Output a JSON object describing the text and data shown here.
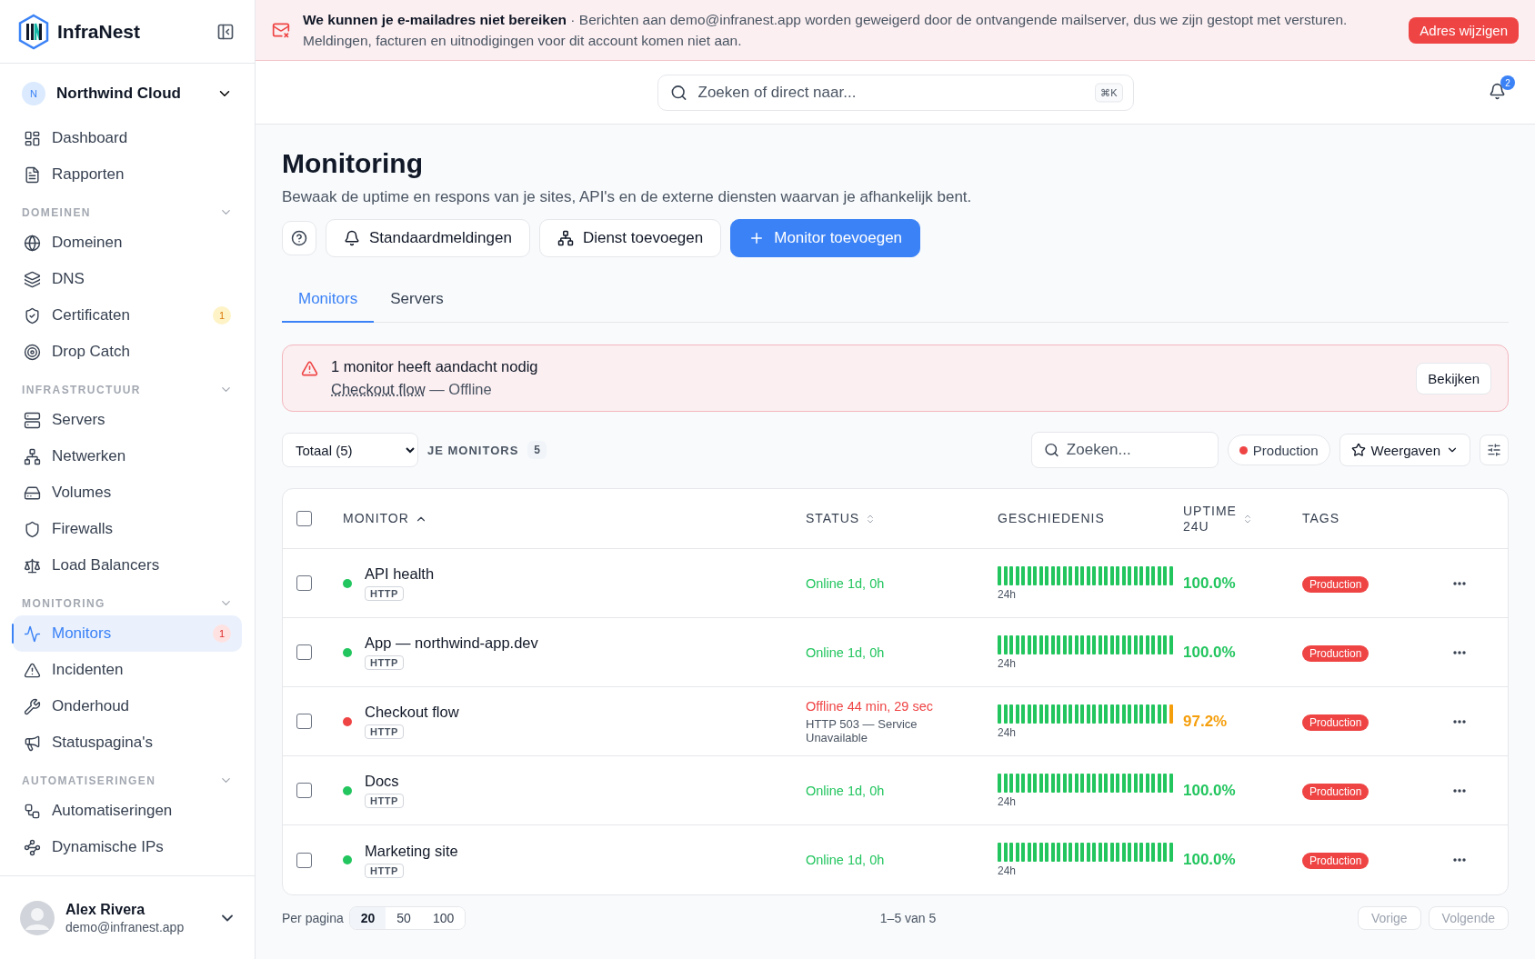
{
  "sidebar": {
    "brand": "InfraNest",
    "workspace": {
      "initial": "N",
      "name": "Northwind Cloud"
    },
    "groups": [
      {
        "items": [
          {
            "label": "Dashboard",
            "selected": false
          },
          {
            "label": "Rapporten",
            "selected": false
          }
        ]
      },
      {
        "heading": "DOMEINEN",
        "expanded": true,
        "items": [
          {
            "label": "Domeinen",
            "selected": false
          },
          {
            "label": "DNS",
            "selected": false
          },
          {
            "label": "Certificaten",
            "selected": false,
            "badge": {
              "text": "1",
              "kind": "warning"
            }
          },
          {
            "label": "Drop Catch",
            "selected": false
          }
        ]
      },
      {
        "heading": "INFRASTRUCTUUR",
        "expanded": true,
        "items": [
          {
            "label": "Servers",
            "selected": false
          },
          {
            "label": "Netwerken",
            "selected": false
          },
          {
            "label": "Volumes",
            "selected": false
          },
          {
            "label": "Firewalls",
            "selected": false
          },
          {
            "label": "Load Balancers",
            "selected": false
          }
        ]
      },
      {
        "heading": "MONITORING",
        "expanded": true,
        "items": [
          {
            "label": "Monitors",
            "selected": true,
            "badge": {
              "text": "1",
              "kind": "danger"
            }
          },
          {
            "label": "Incidenten",
            "selected": false
          },
          {
            "label": "Onderhoud",
            "selected": false
          },
          {
            "label": "Statuspagina's",
            "selected": false
          }
        ]
      },
      {
        "heading": "AUTOMATISERINGEN",
        "expanded": true,
        "items": [
          {
            "label": "Automatiseringen",
            "selected": false
          },
          {
            "label": "Dynamische IPs",
            "selected": false
          }
        ]
      }
    ],
    "user": {
      "name": "Alex Rivera",
      "email": "demo@infranest.app"
    }
  },
  "banner": {
    "title": "We kunnen je e-mailadres niet bereiken",
    "message": " · Berichten aan demo@infranest.app worden geweigerd door de ontvangende mailserver, dus we zijn gestopt met versturen. Meldingen, facturen en uitnodigingen voor dit account komen niet aan.",
    "action": "Adres wijzigen"
  },
  "topbar": {
    "search_placeholder": "Zoeken of direct naar...",
    "shortcut": "⌘K",
    "notifications": "2"
  },
  "page": {
    "title": "Monitoring",
    "description": "Bewaak de uptime en respons van je sites, API's en de externe diensten waarvan je afhankelijk bent.",
    "actions": [
      {
        "label": "Standaardmeldingen",
        "kind": "secondary"
      },
      {
        "label": "Dienst toevoegen",
        "kind": "secondary"
      },
      {
        "label": "Monitor toevoegen",
        "kind": "primary"
      }
    ],
    "tabs": [
      {
        "label": "Monitors",
        "selected": true
      },
      {
        "label": "Servers",
        "selected": false
      }
    ]
  },
  "alert": {
    "title": "1 monitor heeft aandacht nodig",
    "link": "Checkout flow",
    "detail": " — Offline",
    "action": "Bekijken"
  },
  "toolbar": {
    "filter": "Totaal (5)",
    "label": "JE MONITORS",
    "count": "5",
    "search_placeholder": "Zoeken...",
    "chip": {
      "label": "Production",
      "color": "#ef4444"
    },
    "views": "Weergaven"
  },
  "table": {
    "columns": [
      {
        "label": "MONITOR",
        "sorted": true
      },
      {
        "label": "STATUS",
        "sorted": false
      },
      {
        "label": "GESCHIEDENIS"
      },
      {
        "label": "UPTIME 24U",
        "sorted": false
      },
      {
        "label": "TAGS"
      }
    ],
    "all_checked": false,
    "rows": [
      {
        "checked": false,
        "online": true,
        "name": "API health",
        "type": "HTTP",
        "status": "Online 1d, 0h",
        "history_ok": [
          true,
          true,
          true,
          true,
          true,
          true,
          true,
          true,
          true,
          true,
          true,
          true,
          true,
          true,
          true,
          true,
          true,
          true,
          true,
          true,
          true,
          true,
          true,
          true,
          true,
          true,
          true,
          true,
          true,
          true
        ],
        "history_label": "24h",
        "uptime": "100.0%",
        "tags": [
          {
            "label": "Production",
            "color": "#ef4444"
          }
        ]
      },
      {
        "checked": false,
        "online": true,
        "name": "App — northwind-app.dev",
        "type": "HTTP",
        "status": "Online 1d, 0h",
        "history_ok": [
          true,
          true,
          true,
          true,
          true,
          true,
          true,
          true,
          true,
          true,
          true,
          true,
          true,
          true,
          true,
          true,
          true,
          true,
          true,
          true,
          true,
          true,
          true,
          true,
          true,
          true,
          true,
          true,
          true,
          true
        ],
        "history_label": "24h",
        "uptime": "100.0%",
        "tags": [
          {
            "label": "Production",
            "color": "#ef4444"
          }
        ]
      },
      {
        "checked": false,
        "online": false,
        "name": "Checkout flow",
        "type": "HTTP",
        "status": "Offline 44 min, 29 sec",
        "status_detail": "HTTP 503 — Service Unavailable",
        "history_ok": [
          true,
          true,
          true,
          true,
          true,
          true,
          true,
          true,
          true,
          true,
          true,
          true,
          true,
          true,
          true,
          true,
          true,
          true,
          true,
          true,
          true,
          true,
          true,
          true,
          true,
          true,
          true,
          true,
          true,
          false
        ],
        "history_label": "24h",
        "uptime": "97.2%",
        "tags": [
          {
            "label": "Production",
            "color": "#ef4444"
          }
        ]
      },
      {
        "checked": false,
        "online": true,
        "name": "Docs",
        "type": "HTTP",
        "status": "Online 1d, 0h",
        "history_ok": [
          true,
          true,
          true,
          true,
          true,
          true,
          true,
          true,
          true,
          true,
          true,
          true,
          true,
          true,
          true,
          true,
          true,
          true,
          true,
          true,
          true,
          true,
          true,
          true,
          true,
          true,
          true,
          true,
          true,
          true
        ],
        "history_label": "24h",
        "uptime": "100.0%",
        "tags": [
          {
            "label": "Production",
            "color": "#ef4444"
          }
        ]
      },
      {
        "checked": false,
        "online": true,
        "name": "Marketing site",
        "type": "HTTP",
        "status": "Online 1d, 0h",
        "history_ok": [
          true,
          true,
          true,
          true,
          true,
          true,
          true,
          true,
          true,
          true,
          true,
          true,
          true,
          true,
          true,
          true,
          true,
          true,
          true,
          true,
          true,
          true,
          true,
          true,
          true,
          true,
          true,
          true,
          true,
          true
        ],
        "history_label": "24h",
        "uptime": "100.0%",
        "tags": [
          {
            "label": "Production",
            "color": "#ef4444"
          }
        ]
      }
    ]
  },
  "pagination": {
    "label": "Per pagina",
    "sizes": [
      {
        "label": "20",
        "selected": true
      },
      {
        "label": "50",
        "selected": false
      },
      {
        "label": "100",
        "selected": false
      }
    ],
    "range": "1–5 van 5",
    "prev": "Vorige",
    "next": "Volgende"
  }
}
